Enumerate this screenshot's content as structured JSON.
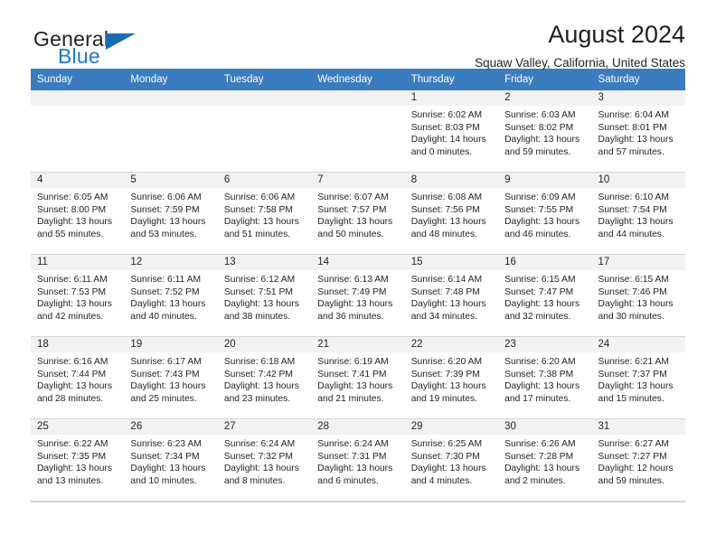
{
  "brand": {
    "word_one": "General",
    "word_two": "Blue",
    "flag_icon": "blue-triangle-flag",
    "accent_color": "#1b6cb3"
  },
  "header": {
    "title": "August 2024",
    "subtitle": "Squaw Valley, California, United States"
  },
  "calendar": {
    "header_bg": "#3b7cbe",
    "daynum_bg": "#f2f2f2",
    "weekday_headers": [
      "Sunday",
      "Monday",
      "Tuesday",
      "Wednesday",
      "Thursday",
      "Friday",
      "Saturday"
    ],
    "weeks": [
      [
        {
          "day": "",
          "empty": true
        },
        {
          "day": "",
          "empty": true
        },
        {
          "day": "",
          "empty": true
        },
        {
          "day": "",
          "empty": true
        },
        {
          "day": "1",
          "sunrise": "Sunrise: 6:02 AM",
          "sunset": "Sunset: 8:03 PM",
          "daylight": "Daylight: 14 hours and 0 minutes."
        },
        {
          "day": "2",
          "sunrise": "Sunrise: 6:03 AM",
          "sunset": "Sunset: 8:02 PM",
          "daylight": "Daylight: 13 hours and 59 minutes."
        },
        {
          "day": "3",
          "sunrise": "Sunrise: 6:04 AM",
          "sunset": "Sunset: 8:01 PM",
          "daylight": "Daylight: 13 hours and 57 minutes."
        }
      ],
      [
        {
          "day": "4",
          "sunrise": "Sunrise: 6:05 AM",
          "sunset": "Sunset: 8:00 PM",
          "daylight": "Daylight: 13 hours and 55 minutes."
        },
        {
          "day": "5",
          "sunrise": "Sunrise: 6:06 AM",
          "sunset": "Sunset: 7:59 PM",
          "daylight": "Daylight: 13 hours and 53 minutes."
        },
        {
          "day": "6",
          "sunrise": "Sunrise: 6:06 AM",
          "sunset": "Sunset: 7:58 PM",
          "daylight": "Daylight: 13 hours and 51 minutes."
        },
        {
          "day": "7",
          "sunrise": "Sunrise: 6:07 AM",
          "sunset": "Sunset: 7:57 PM",
          "daylight": "Daylight: 13 hours and 50 minutes."
        },
        {
          "day": "8",
          "sunrise": "Sunrise: 6:08 AM",
          "sunset": "Sunset: 7:56 PM",
          "daylight": "Daylight: 13 hours and 48 minutes."
        },
        {
          "day": "9",
          "sunrise": "Sunrise: 6:09 AM",
          "sunset": "Sunset: 7:55 PM",
          "daylight": "Daylight: 13 hours and 46 minutes."
        },
        {
          "day": "10",
          "sunrise": "Sunrise: 6:10 AM",
          "sunset": "Sunset: 7:54 PM",
          "daylight": "Daylight: 13 hours and 44 minutes."
        }
      ],
      [
        {
          "day": "11",
          "sunrise": "Sunrise: 6:11 AM",
          "sunset": "Sunset: 7:53 PM",
          "daylight": "Daylight: 13 hours and 42 minutes."
        },
        {
          "day": "12",
          "sunrise": "Sunrise: 6:11 AM",
          "sunset": "Sunset: 7:52 PM",
          "daylight": "Daylight: 13 hours and 40 minutes."
        },
        {
          "day": "13",
          "sunrise": "Sunrise: 6:12 AM",
          "sunset": "Sunset: 7:51 PM",
          "daylight": "Daylight: 13 hours and 38 minutes."
        },
        {
          "day": "14",
          "sunrise": "Sunrise: 6:13 AM",
          "sunset": "Sunset: 7:49 PM",
          "daylight": "Daylight: 13 hours and 36 minutes."
        },
        {
          "day": "15",
          "sunrise": "Sunrise: 6:14 AM",
          "sunset": "Sunset: 7:48 PM",
          "daylight": "Daylight: 13 hours and 34 minutes."
        },
        {
          "day": "16",
          "sunrise": "Sunrise: 6:15 AM",
          "sunset": "Sunset: 7:47 PM",
          "daylight": "Daylight: 13 hours and 32 minutes."
        },
        {
          "day": "17",
          "sunrise": "Sunrise: 6:15 AM",
          "sunset": "Sunset: 7:46 PM",
          "daylight": "Daylight: 13 hours and 30 minutes."
        }
      ],
      [
        {
          "day": "18",
          "sunrise": "Sunrise: 6:16 AM",
          "sunset": "Sunset: 7:44 PM",
          "daylight": "Daylight: 13 hours and 28 minutes."
        },
        {
          "day": "19",
          "sunrise": "Sunrise: 6:17 AM",
          "sunset": "Sunset: 7:43 PM",
          "daylight": "Daylight: 13 hours and 25 minutes."
        },
        {
          "day": "20",
          "sunrise": "Sunrise: 6:18 AM",
          "sunset": "Sunset: 7:42 PM",
          "daylight": "Daylight: 13 hours and 23 minutes."
        },
        {
          "day": "21",
          "sunrise": "Sunrise: 6:19 AM",
          "sunset": "Sunset: 7:41 PM",
          "daylight": "Daylight: 13 hours and 21 minutes."
        },
        {
          "day": "22",
          "sunrise": "Sunrise: 6:20 AM",
          "sunset": "Sunset: 7:39 PM",
          "daylight": "Daylight: 13 hours and 19 minutes."
        },
        {
          "day": "23",
          "sunrise": "Sunrise: 6:20 AM",
          "sunset": "Sunset: 7:38 PM",
          "daylight": "Daylight: 13 hours and 17 minutes."
        },
        {
          "day": "24",
          "sunrise": "Sunrise: 6:21 AM",
          "sunset": "Sunset: 7:37 PM",
          "daylight": "Daylight: 13 hours and 15 minutes."
        }
      ],
      [
        {
          "day": "25",
          "sunrise": "Sunrise: 6:22 AM",
          "sunset": "Sunset: 7:35 PM",
          "daylight": "Daylight: 13 hours and 13 minutes."
        },
        {
          "day": "26",
          "sunrise": "Sunrise: 6:23 AM",
          "sunset": "Sunset: 7:34 PM",
          "daylight": "Daylight: 13 hours and 10 minutes."
        },
        {
          "day": "27",
          "sunrise": "Sunrise: 6:24 AM",
          "sunset": "Sunset: 7:32 PM",
          "daylight": "Daylight: 13 hours and 8 minutes."
        },
        {
          "day": "28",
          "sunrise": "Sunrise: 6:24 AM",
          "sunset": "Sunset: 7:31 PM",
          "daylight": "Daylight: 13 hours and 6 minutes."
        },
        {
          "day": "29",
          "sunrise": "Sunrise: 6:25 AM",
          "sunset": "Sunset: 7:30 PM",
          "daylight": "Daylight: 13 hours and 4 minutes."
        },
        {
          "day": "30",
          "sunrise": "Sunrise: 6:26 AM",
          "sunset": "Sunset: 7:28 PM",
          "daylight": "Daylight: 13 hours and 2 minutes."
        },
        {
          "day": "31",
          "sunrise": "Sunrise: 6:27 AM",
          "sunset": "Sunset: 7:27 PM",
          "daylight": "Daylight: 12 hours and 59 minutes."
        }
      ]
    ]
  }
}
